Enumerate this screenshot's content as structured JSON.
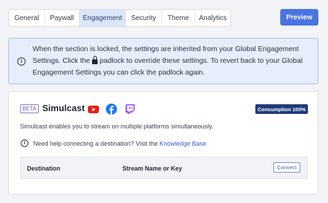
{
  "tabs": [
    {
      "label": "General"
    },
    {
      "label": "Paywall"
    },
    {
      "label": "Engagement",
      "active": true
    },
    {
      "label": "Security"
    },
    {
      "label": "Theme"
    },
    {
      "label": "Analytics"
    }
  ],
  "header": {
    "preview_label": "Preview"
  },
  "notice": {
    "text_before_lock": "When the section is locked, the settings are inherited from your Global Engagement Settings. Click the",
    "text_after_lock": "padlock to override these settings. To revert back to your Global Engagement Settings you can click the padlock again.",
    "icon": "info-icon"
  },
  "simulcast": {
    "badge": "BETA",
    "title": "Simulcast",
    "platform_icons": [
      "youtube-icon",
      "facebook-icon",
      "twitch-icon"
    ],
    "consumption": "Consumption 100%",
    "description": "Simulcast enables you to stream on multiple platforms simultaneously.",
    "help_text": "Need help connecting a destination? Visit the",
    "help_link": "Knowledge Base",
    "table": {
      "col_destination": "Destination",
      "col_stream": "Stream Name or Key",
      "connect_label": "Connect"
    }
  },
  "colors": {
    "accent": "#4a74e0",
    "active_tab": "#dbe6fb",
    "notice_bg": "#e6eefb",
    "badge_bg": "#22397a",
    "youtube": "#e62117",
    "facebook": "#1877f2",
    "twitch": "#9146ff"
  }
}
